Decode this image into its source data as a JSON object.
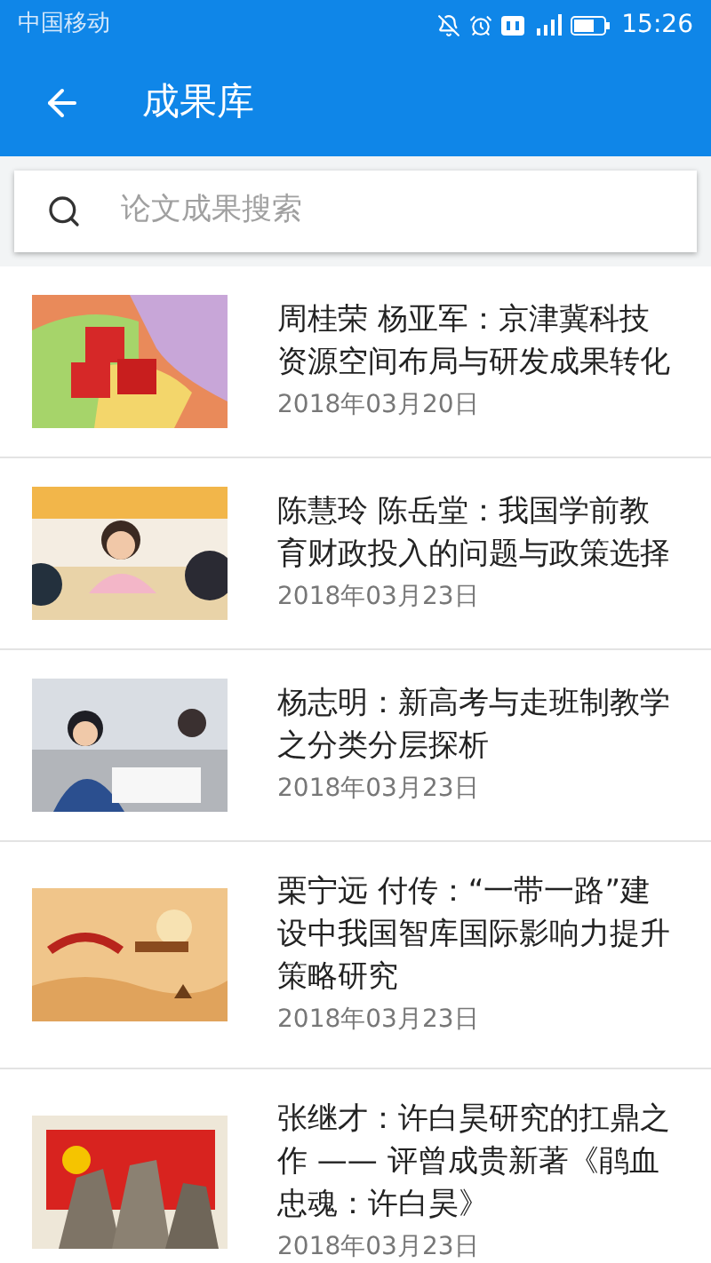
{
  "status_bar": {
    "carrier": "中国移动",
    "time": "15:26"
  },
  "toolbar": {
    "title": "成果库"
  },
  "search": {
    "placeholder": "论文成果搜索"
  },
  "items": [
    {
      "title": "周桂荣 杨亚军：京津冀科技资源空间布局与研发成果转化",
      "date": "2018年03月20日"
    },
    {
      "title": "陈慧玲 陈岳堂：我国学前教育财政投入的问题与政策选择",
      "date": "2018年03月23日"
    },
    {
      "title": "杨志明：新高考与走班制教学之分类分层探析",
      "date": "2018年03月23日"
    },
    {
      "title": "栗宁远 付传：“一带一路”建设中我国智库国际影响力提升策略研究",
      "date": "2018年03月23日"
    },
    {
      "title": "张继才：许白昊研究的扛鼎之作 —— 评曾成贵新著《鹃血忠魂：许白昊》",
      "date": "2018年03月23日"
    }
  ]
}
